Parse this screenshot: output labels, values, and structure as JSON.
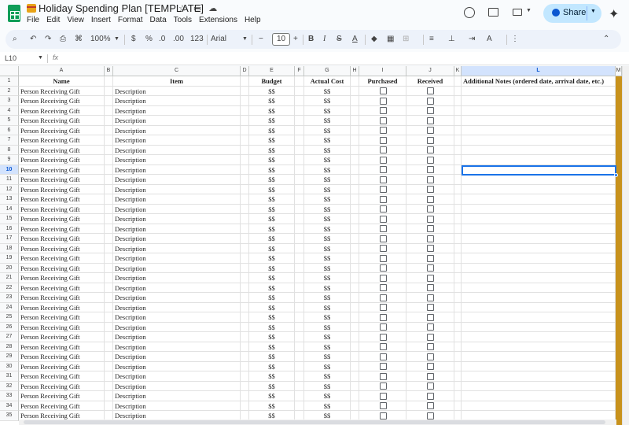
{
  "app": {
    "title": "Holiday Spending Plan [TEMPLATE]",
    "menu": [
      "File",
      "Edit",
      "View",
      "Insert",
      "Format",
      "Data",
      "Tools",
      "Extensions",
      "Help"
    ],
    "share_label": "Share",
    "colors": {
      "accent": "#0b57d0",
      "share_bg": "#c2e7ff",
      "sheets_green": "#0f9d58",
      "column_m_fill": "#c8921c",
      "selection": "#1a73e8"
    }
  },
  "toolbar": {
    "zoom": "100%",
    "currency": "$",
    "percent": "%",
    "dec_decrease": ".0",
    "dec_increase": ".00",
    "number_format": "123",
    "font": "Arial",
    "font_size": "10",
    "bold": "B",
    "italic": "I",
    "icons": [
      "search-icon",
      "undo-icon",
      "redo-icon",
      "print-icon",
      "paint-format-icon",
      "strikethrough-icon",
      "text-color-icon",
      "fill-color-icon",
      "borders-icon",
      "merge-cells-icon",
      "align-icon",
      "valign-icon",
      "text-wrap-icon",
      "text-rotate-icon",
      "more-icon",
      "collapse-icon"
    ]
  },
  "formula_bar": {
    "cell_ref": "L10",
    "fx": "fx",
    "value": ""
  },
  "sheet": {
    "columns": [
      "A",
      "B",
      "C",
      "D",
      "E",
      "F",
      "G",
      "H",
      "I",
      "J",
      "K",
      "L",
      "M"
    ],
    "selected_column": "L",
    "selected_row": 10,
    "headers": {
      "name": "Name",
      "item": "Item",
      "budget": "Budget",
      "actual": "Actual Cost",
      "purchased": "Purchased",
      "received": "Received",
      "notes": "Additional Notes (ordered date, arrival date, etc.)"
    },
    "row_template": {
      "name": "Person Receiving Gift",
      "item": "Description",
      "budget": "$$",
      "actual": "$$",
      "purchased": false,
      "received": false
    },
    "first_row": 1,
    "data_rows": [
      2,
      3,
      4,
      5,
      6,
      7,
      8,
      9,
      10,
      11,
      12,
      13,
      14,
      15,
      16,
      17,
      18,
      19,
      20,
      21,
      22,
      23,
      24,
      25,
      26,
      27,
      28,
      29,
      30,
      31,
      32,
      33,
      34,
      35
    ]
  }
}
